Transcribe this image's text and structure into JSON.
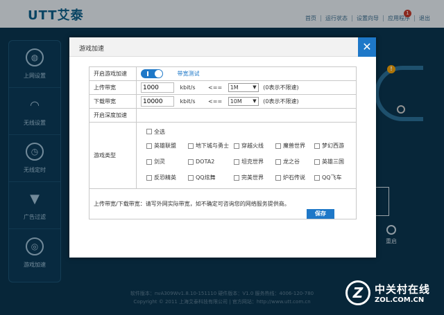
{
  "app": {
    "logo": "UTT艾泰",
    "nav": [
      "首页",
      "运行状态",
      "设置向导",
      "应用程序",
      "退出"
    ],
    "badge_count": "1",
    "sidebar": [
      {
        "label": "上网设置",
        "icon": "globe-icon"
      },
      {
        "label": "无线设置",
        "icon": "wifi-icon"
      },
      {
        "label": "无线定时",
        "icon": "timer-icon"
      },
      {
        "label": "广告过滤",
        "icon": "funnel-icon"
      },
      {
        "label": "游戏加速",
        "icon": "game-target-icon"
      }
    ],
    "reboot_label": "重启",
    "footer_line1": "软件版本：nvA309Wv1.8.10-151110   硬件版本：V1.0   服务热线：4006-120-780",
    "footer_line2": "Copyright © 2011 上海艾泰科技有限公司  |  官方网站：http://www.utt.com.cn",
    "watermark_main": "中关村在线",
    "watermark_sub": "ZOL.COM.CN",
    "watermark_mark": "Z"
  },
  "dialog": {
    "title": "游戏加速",
    "close_glyph": "✕",
    "enable_label": "开启游戏加速",
    "enable_state": true,
    "bandwidth_test_link": "带宽测试",
    "upload_label": "上传带宽",
    "upload_value": "1000",
    "upload_unit": "kbit/s",
    "upload_arrow": "<==",
    "upload_select": "1M",
    "upload_hint": "(0表示不限速)",
    "download_label": "下载带宽",
    "download_value": "10000",
    "download_unit": "kbit/s",
    "download_arrow": "<==",
    "download_select": "10M",
    "download_hint": "(0表示不限速)",
    "deep_accel_link": "开启深度加速",
    "game_type_label": "游戏类型",
    "select_all": "全选",
    "games": [
      [
        "英雄联盟",
        "地下城与勇士",
        "穿越火线",
        "魔兽世界",
        "梦幻西游"
      ],
      [
        "剑灵",
        "DOTA2",
        "坦克世界",
        "龙之谷",
        "英雄三国"
      ],
      [
        "反恐精英",
        "QQ炫舞",
        "完美世界",
        "炉石传说",
        "QQ飞车"
      ]
    ],
    "note": "上传带宽/下载带宽：请写外网实际带宽，如不确定可咨询您的网络服务提供商。",
    "save_label": "保存"
  },
  "colors": {
    "accent": "#1e78c8",
    "background": "#0b3550",
    "link_green": "#7cb342"
  }
}
